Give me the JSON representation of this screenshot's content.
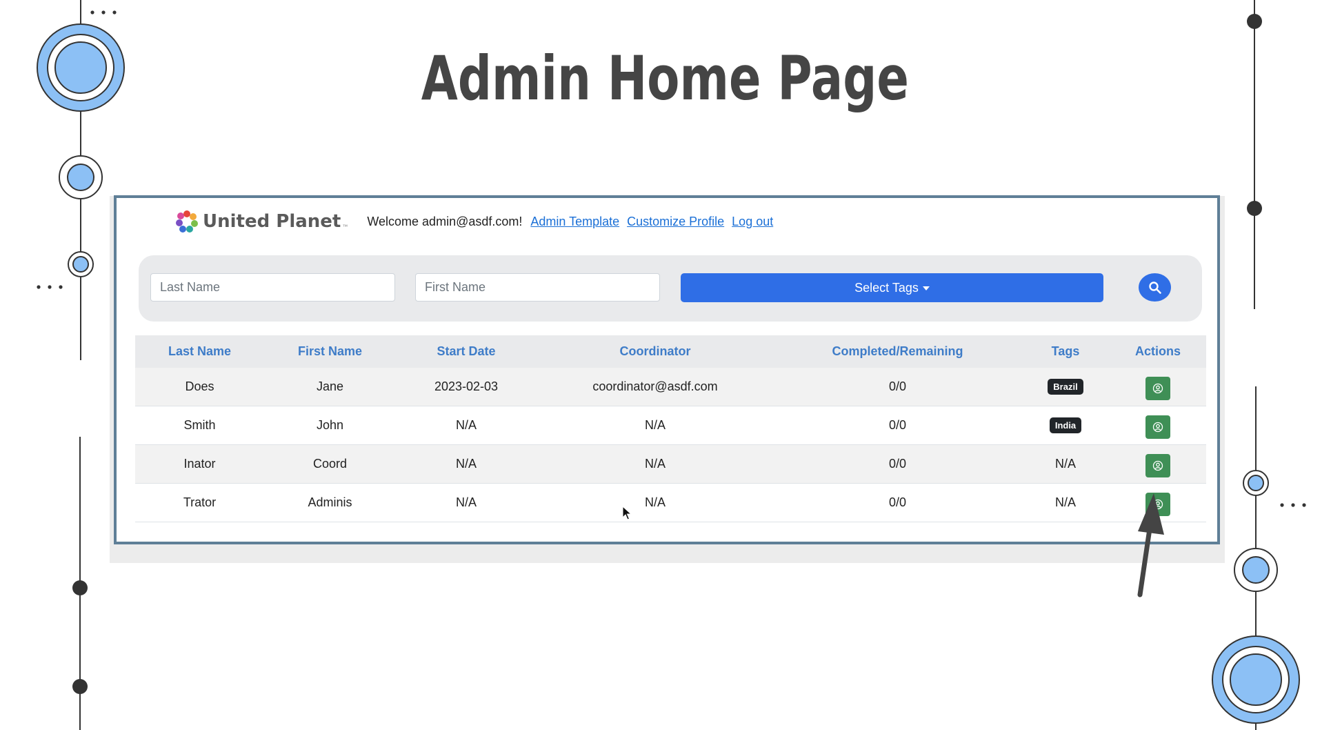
{
  "slide": {
    "title": "Admin Home Page"
  },
  "navbar": {
    "brand": "United Planet",
    "welcome": "Welcome admin@asdf.com!",
    "links": [
      "Admin Template",
      "Customize Profile",
      "Log out"
    ]
  },
  "search": {
    "last_name_placeholder": "Last Name",
    "first_name_placeholder": "First Name",
    "tags_button_label": "Select Tags"
  },
  "table": {
    "headers": [
      "Last Name",
      "First Name",
      "Start Date",
      "Coordinator",
      "Completed/Remaining",
      "Tags",
      "Actions"
    ],
    "rows": [
      {
        "last_name": "Does",
        "first_name": "Jane",
        "start_date": "2023-02-03",
        "coordinator": "coordinator@asdf.com",
        "progress": "0/0",
        "tag": "Brazil",
        "tag_is_badge": true
      },
      {
        "last_name": "Smith",
        "first_name": "John",
        "start_date": "N/A",
        "coordinator": "N/A",
        "progress": "0/0",
        "tag": "India",
        "tag_is_badge": true
      },
      {
        "last_name": "Inator",
        "first_name": "Coord",
        "start_date": "N/A",
        "coordinator": "N/A",
        "progress": "0/0",
        "tag": "N/A",
        "tag_is_badge": false
      },
      {
        "last_name": "Trator",
        "first_name": "Adminis",
        "start_date": "N/A",
        "coordinator": "N/A",
        "progress": "0/0",
        "tag": "N/A",
        "tag_is_badge": false
      }
    ],
    "action_icon": "user-circle-icon"
  },
  "colors": {
    "accent_blue": "#2f6ee6",
    "header_text": "#3e7cc8",
    "action_green": "#3f8f56",
    "frame_border": "#5f7f97",
    "decoration_blue": "#8cc0f5"
  }
}
